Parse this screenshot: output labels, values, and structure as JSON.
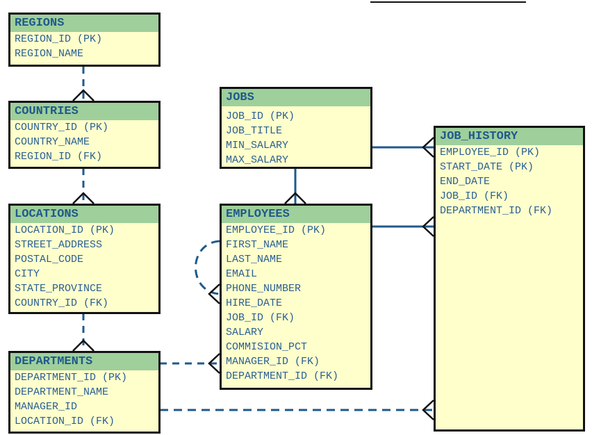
{
  "entities": {
    "regions": {
      "title": "REGIONS",
      "columns": [
        "REGION_ID (PK)",
        "REGION_NAME"
      ]
    },
    "countries": {
      "title": "COUNTRIES",
      "columns": [
        "COUNTRY_ID (PK)",
        "COUNTRY_NAME",
        "REGION_ID (FK)"
      ]
    },
    "locations": {
      "title": "LOCATIONS",
      "columns": [
        "LOCATION_ID (PK)",
        "STREET_ADDRESS",
        "POSTAL_CODE",
        "CITY",
        "STATE_PROVINCE",
        "COUNTRY_ID (FK)"
      ]
    },
    "departments": {
      "title": "DEPARTMENTS",
      "columns": [
        "DEPARTMENT_ID (PK)",
        "DEPARTMENT_NAME",
        "MANAGER_ID",
        "LOCATION_ID (FK)"
      ]
    },
    "jobs": {
      "title": "JOBS",
      "columns": [
        "JOB_ID (PK)",
        "JOB_TITLE",
        "MIN_SALARY",
        "MAX_SALARY"
      ]
    },
    "employees": {
      "title": "EMPLOYEES",
      "columns": [
        "EMPLOYEE_ID (PK)",
        "FIRST_NAME",
        "LAST_NAME",
        "EMAIL",
        "PHONE_NUMBER",
        "HIRE_DATE",
        "JOB_ID (FK)",
        "SALARY",
        "COMMISION_PCT",
        "MANAGER_ID (FK)",
        "DEPARTMENT_ID (FK)"
      ]
    },
    "job_history": {
      "title": "JOB_HISTORY",
      "columns": [
        "EMPLOYEE_ID (PK)",
        "START_DATE (PK)",
        "END_DATE",
        "JOB_ID (FK)",
        "DEPARTMENT_ID (FK)"
      ]
    }
  },
  "colors": {
    "header": "#9fcf9b",
    "body": "#ffffcc",
    "text": "#2a5f95",
    "line": "#1f5a8c"
  }
}
